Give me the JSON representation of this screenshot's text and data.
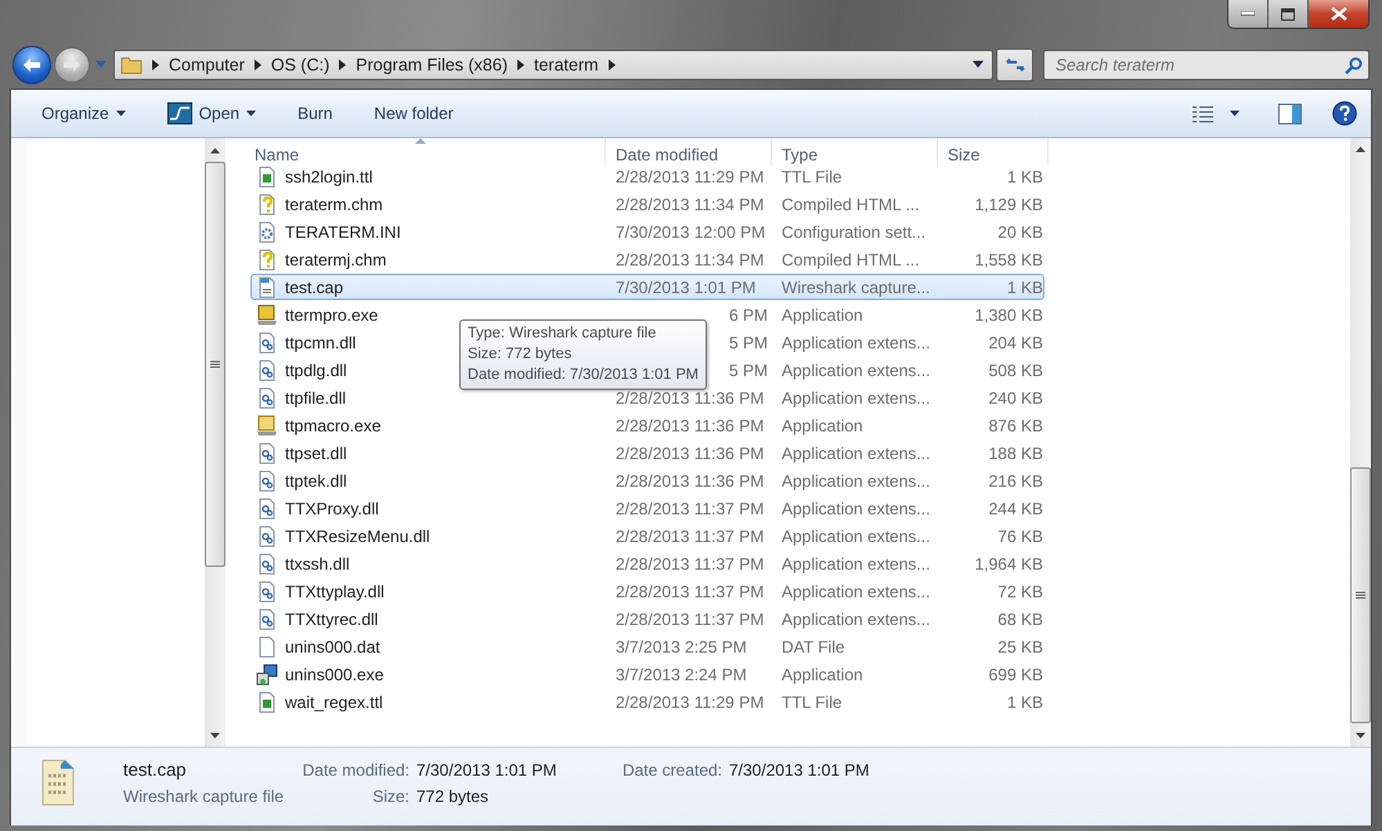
{
  "address_bar": {
    "path": [
      "Computer",
      "OS (C:)",
      "Program Files (x86)",
      "teraterm"
    ]
  },
  "search": {
    "placeholder": "Search teraterm"
  },
  "toolbar": {
    "buttons": [
      {
        "label": "Organize",
        "kind": "menu"
      },
      {
        "label": "Open",
        "kind": "app"
      },
      {
        "label": "Burn",
        "kind": "plain"
      },
      {
        "label": "New folder",
        "kind": "plain"
      }
    ]
  },
  "table": {
    "columns": [
      {
        "label": "Name",
        "sorted": true
      },
      {
        "label": "Date modified",
        "sorted": false
      },
      {
        "label": "Type",
        "sorted": false
      },
      {
        "label": "Size",
        "sorted": false
      }
    ],
    "rows": [
      {
        "kind": "ttl",
        "name": "ssh2login.ttl",
        "date": "2/28/2013 11:29 PM",
        "type": "TTL File",
        "size": "1 KB",
        "selected": false,
        "covered": false
      },
      {
        "kind": "chm",
        "name": "teraterm.chm",
        "date": "2/28/2013 11:34 PM",
        "type": "Compiled HTML ...",
        "size": "1,129 KB",
        "selected": false,
        "covered": false
      },
      {
        "kind": "ini",
        "name": "TERATERM.INI",
        "date": "7/30/2013 12:00 PM",
        "type": "Configuration sett...",
        "size": "20 KB",
        "selected": false,
        "covered": false
      },
      {
        "kind": "chm",
        "name": "teratermj.chm",
        "date": "2/28/2013 11:34 PM",
        "type": "Compiled HTML ...",
        "size": "1,558 KB",
        "selected": false,
        "covered": false
      },
      {
        "kind": "cap",
        "name": "test.cap",
        "date": "7/30/2013 1:01 PM",
        "type": "Wireshark capture...",
        "size": "1 KB",
        "selected": true,
        "covered": false
      },
      {
        "kind": "term",
        "name": "ttermpro.exe",
        "date": "6 PM",
        "type": "Application",
        "size": "1,380 KB",
        "selected": false,
        "covered": true
      },
      {
        "kind": "dll",
        "name": "ttpcmn.dll",
        "date": "5 PM",
        "type": "Application extens...",
        "size": "204 KB",
        "selected": false,
        "covered": true
      },
      {
        "kind": "dll",
        "name": "ttpdlg.dll",
        "date": "5 PM",
        "type": "Application extens...",
        "size": "508 KB",
        "selected": false,
        "covered": true
      },
      {
        "kind": "dll",
        "name": "ttpfile.dll",
        "date": "2/28/2013 11:36 PM",
        "type": "Application extens...",
        "size": "240 KB",
        "selected": false,
        "covered": false
      },
      {
        "kind": "macro",
        "name": "ttpmacro.exe",
        "date": "2/28/2013 11:36 PM",
        "type": "Application",
        "size": "876 KB",
        "selected": false,
        "covered": false
      },
      {
        "kind": "dll",
        "name": "ttpset.dll",
        "date": "2/28/2013 11:36 PM",
        "type": "Application extens...",
        "size": "188 KB",
        "selected": false,
        "covered": false
      },
      {
        "kind": "dll",
        "name": "ttptek.dll",
        "date": "2/28/2013 11:36 PM",
        "type": "Application extens...",
        "size": "216 KB",
        "selected": false,
        "covered": false
      },
      {
        "kind": "dll",
        "name": "TTXProxy.dll",
        "date": "2/28/2013 11:37 PM",
        "type": "Application extens...",
        "size": "244 KB",
        "selected": false,
        "covered": false
      },
      {
        "kind": "dll",
        "name": "TTXResizeMenu.dll",
        "date": "2/28/2013 11:37 PM",
        "type": "Application extens...",
        "size": "76 KB",
        "selected": false,
        "covered": false
      },
      {
        "kind": "dll",
        "name": "ttxssh.dll",
        "date": "2/28/2013 11:37 PM",
        "type": "Application extens...",
        "size": "1,964 KB",
        "selected": false,
        "covered": false
      },
      {
        "kind": "dll",
        "name": "TTXttyplay.dll",
        "date": "2/28/2013 11:37 PM",
        "type": "Application extens...",
        "size": "72 KB",
        "selected": false,
        "covered": false
      },
      {
        "kind": "dll",
        "name": "TTXttyrec.dll",
        "date": "2/28/2013 11:37 PM",
        "type": "Application extens...",
        "size": "68 KB",
        "selected": false,
        "covered": false
      },
      {
        "kind": "dat",
        "name": "unins000.dat",
        "date": "3/7/2013 2:25 PM",
        "type": "DAT File",
        "size": "25 KB",
        "selected": false,
        "covered": false
      },
      {
        "kind": "setup",
        "name": "unins000.exe",
        "date": "3/7/2013 2:24 PM",
        "type": "Application",
        "size": "699 KB",
        "selected": false,
        "covered": false
      },
      {
        "kind": "ttl",
        "name": "wait_regex.ttl",
        "date": "2/28/2013 11:29 PM",
        "type": "TTL File",
        "size": "1 KB",
        "selected": false,
        "covered": false
      }
    ]
  },
  "tooltip": {
    "lines": [
      "Type: Wireshark capture file",
      "Size: 772 bytes",
      "Date modified: 7/30/2013 1:01 PM"
    ]
  },
  "details_pane": {
    "name": "test.cap",
    "type": "Wireshark capture file",
    "fields": [
      {
        "label": "Date modified:",
        "value": "7/30/2013 1:01 PM"
      },
      {
        "label": "Size:",
        "value": "772 bytes"
      },
      {
        "label": "Date created:",
        "value": "7/30/2013 1:01 PM"
      }
    ]
  }
}
